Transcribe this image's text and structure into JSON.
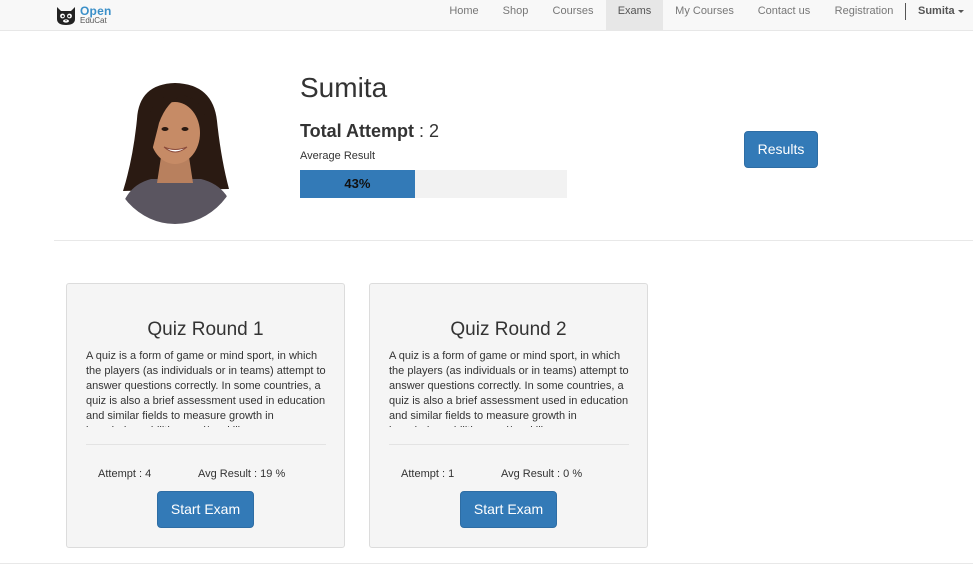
{
  "brand": {
    "name_top": "Open",
    "name_bottom": "EduCat",
    "icon": "cat-logo-icon"
  },
  "nav": {
    "items": [
      {
        "label": "Home",
        "active": false
      },
      {
        "label": "Shop",
        "active": false
      },
      {
        "label": "Courses",
        "active": false
      },
      {
        "label": "Exams",
        "active": true
      },
      {
        "label": "My Courses",
        "active": false
      },
      {
        "label": "Contact us",
        "active": false
      },
      {
        "label": "Registration",
        "active": false
      }
    ],
    "user": "Sumita"
  },
  "profile": {
    "name": "Sumita",
    "total_attempt_label": "Total Attempt",
    "total_attempt_value": ": 2",
    "average_result_label": "Average Result",
    "average_result_percent": 43,
    "average_result_text": "43%",
    "results_button": "Results"
  },
  "quizzes": [
    {
      "title": "Quiz Round 1",
      "description": "A quiz is a form of game or mind sport, in which the players (as individuals or in teams) attempt to answer questions correctly. In some countries, a quiz is also a brief assessment used in education and similar fields to measure growth in knowledge, abilities, and/or skills.",
      "attempt": "Attempt : 4",
      "avg_result": "Avg Result : 19 %",
      "button": "Start Exam"
    },
    {
      "title": "Quiz Round 2",
      "description": "A quiz is a form of game or mind sport, in which the players (as individuals or in teams) attempt to answer questions correctly. In some countries, a quiz is also a brief assessment used in education and similar fields to measure growth in knowledge, abilities, and/or skills.",
      "attempt": "Attempt : 1",
      "avg_result": "Avg Result : 0 %",
      "button": "Start Exam"
    }
  ],
  "colors": {
    "primary": "#337ab7",
    "navbar": "#f8f8f8",
    "card": "#f5f5f5",
    "active_nav": "#e7e7e7"
  }
}
